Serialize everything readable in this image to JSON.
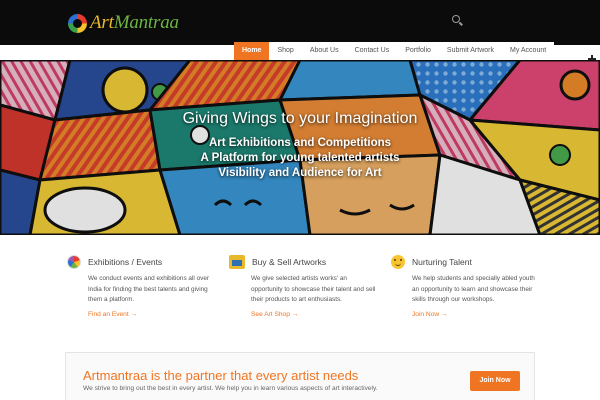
{
  "header": {
    "logo_word_1": "Art",
    "logo_word_2": "Mantraa",
    "nav": [
      {
        "label": "Home",
        "active": true
      },
      {
        "label": "Shop"
      },
      {
        "label": "About Us"
      },
      {
        "label": "Contact Us"
      },
      {
        "label": "Portfolio"
      },
      {
        "label": "Submit Artwork"
      },
      {
        "label": "My Account"
      }
    ]
  },
  "hero": {
    "title": "Giving Wings to your Imagination",
    "lines": [
      "Art Exhibitions and Competitions",
      "A Platform for young talented artists",
      "Visibility and Audience for Art"
    ]
  },
  "features": [
    {
      "icon": "color-palette-icon",
      "title": "Exhibitions / Events",
      "desc": "We conduct events and exhibitions all over India for finding the best talents and giving them a platform.",
      "link": "Find an Event →"
    },
    {
      "icon": "shop-icon",
      "title": "Buy & Sell Artworks",
      "desc": "We give selected artists works' an opportunity to showcase their talent and sell their products to art enthusiasts.",
      "link": "See Art Shop →"
    },
    {
      "icon": "smiley-icon",
      "title": "Nurturing Talent",
      "desc": "We help students and specially abled youth an opportunity to learn and showcase their skills through our workshops.",
      "link": "Join Now →"
    }
  ],
  "partner": {
    "title": "Artmantraa is the partner that every artist needs",
    "subtitle": "We strive to bring out the best in every artist. We help you in learn various aspects of art interactively.",
    "button": "Join Now"
  },
  "colors": {
    "accent": "#f07522",
    "header_bg": "#0b0b0b"
  }
}
